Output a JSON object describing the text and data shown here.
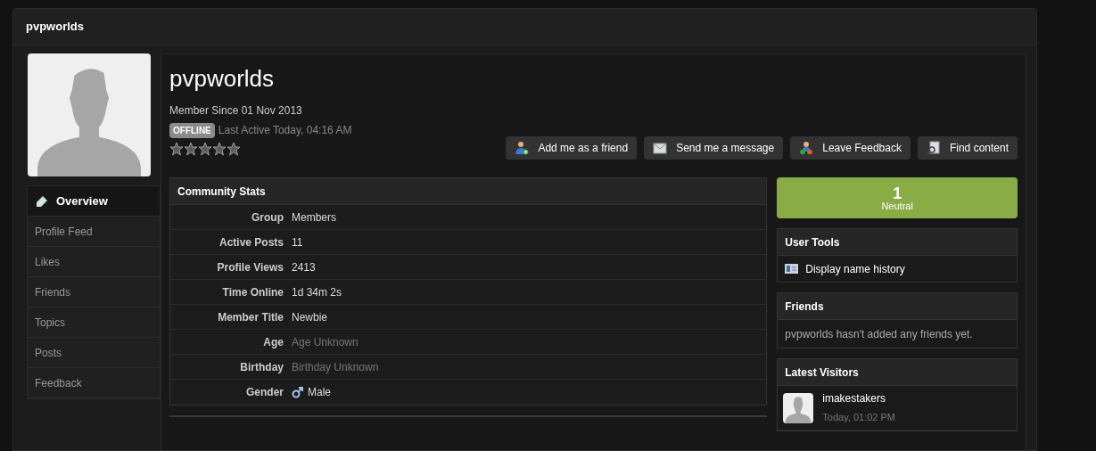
{
  "page_title": "pvpworlds",
  "profile": {
    "name": "pvpworlds",
    "member_since": "Member Since 01 Nov 2013",
    "status_badge": "OFFLINE",
    "last_active": "Last Active Today, 04:16 AM",
    "stars": 0
  },
  "actions": [
    {
      "label": "Add me as a friend",
      "kind": "friend"
    },
    {
      "label": "Send me a message",
      "kind": "message"
    },
    {
      "label": "Leave Feedback",
      "kind": "feedback"
    },
    {
      "label": "Find content",
      "kind": "find"
    }
  ],
  "nav": [
    {
      "label": "Overview",
      "selected": true
    },
    {
      "label": "Profile Feed",
      "selected": false
    },
    {
      "label": "Likes",
      "selected": false
    },
    {
      "label": "Friends",
      "selected": false
    },
    {
      "label": "Topics",
      "selected": false
    },
    {
      "label": "Posts",
      "selected": false
    },
    {
      "label": "Feedback",
      "selected": false
    }
  ],
  "stats": {
    "title": "Community Stats",
    "rows": [
      {
        "label": "Group",
        "value": "Members",
        "kind": "text"
      },
      {
        "label": "Active Posts",
        "value": "11",
        "kind": "text"
      },
      {
        "label": "Profile Views",
        "value": "2413",
        "kind": "text"
      },
      {
        "label": "Time Online",
        "value": "1d 34m 2s",
        "kind": "text"
      },
      {
        "label": "Member Title",
        "value": "Newbie",
        "kind": "text"
      },
      {
        "label": "Age",
        "value": "Age Unknown",
        "kind": "muted"
      },
      {
        "label": "Birthday",
        "value": "Birthday Unknown",
        "kind": "muted"
      },
      {
        "label": "Gender",
        "value": "Male",
        "kind": "gender"
      }
    ]
  },
  "reputation": {
    "count": "1",
    "label": "Neutral"
  },
  "user_tools": {
    "title": "User Tools",
    "items": [
      "Display name history"
    ]
  },
  "friends": {
    "title": "Friends",
    "message": "pvpworlds hasn't added any friends yet."
  },
  "latest_visitors": {
    "title": "Latest Visitors",
    "items": [
      {
        "name": "imakestakers",
        "time": "Today, 01:02 PM"
      }
    ]
  }
}
